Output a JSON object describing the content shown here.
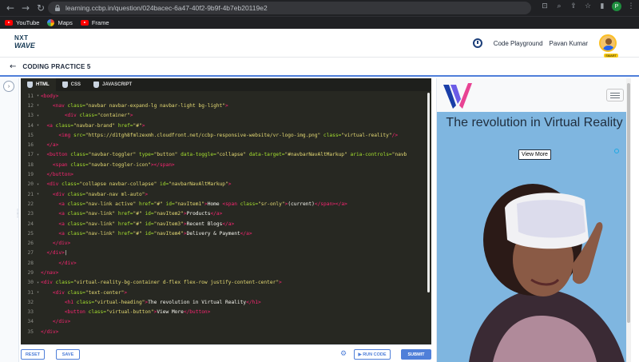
{
  "browser": {
    "url": "learning.ccbp.in/question/024bacec-6a47-40f2-9b9f-4b7eb20119e2",
    "profile_initial": "P",
    "bookmarks": [
      {
        "label": "YouTube",
        "icon": "youtube-icon"
      },
      {
        "label": "Maps",
        "icon": "google-icon"
      },
      {
        "label": "Frame",
        "icon": "youtube-icon"
      }
    ]
  },
  "header": {
    "logo_top": "NXT",
    "logo_bottom": "WAVE",
    "code_playground": "Code Playground",
    "user_name": "Pavan Kumar",
    "avatar_badge": "SMART"
  },
  "practice": {
    "title": "CODING PRACTICE 5"
  },
  "editor": {
    "tabs": [
      "HTML",
      "CSS",
      "JAVASCRIPT"
    ],
    "active_tab": "HTML",
    "lines": [
      {
        "n": "11",
        "fold": "▾",
        "indent": "",
        "parts": [
          [
            "tag",
            "<body>"
          ]
        ]
      },
      {
        "n": "12",
        "fold": "▾",
        "indent": "    ",
        "parts": [
          [
            "tag",
            "<nav "
          ],
          [
            "attr",
            "class="
          ],
          [
            "str",
            "\"navbar navbar-expand-lg navbar-light bg-light\""
          ],
          [
            "tag",
            ">"
          ]
        ]
      },
      {
        "n": "13",
        "fold": "▾",
        "indent": "        ",
        "parts": [
          [
            "tag",
            "<div "
          ],
          [
            "attr",
            "class="
          ],
          [
            "str",
            "\"container\""
          ],
          [
            "tag",
            ">"
          ]
        ]
      },
      {
        "n": "14",
        "fold": "▾",
        "indent": "  ",
        "parts": [
          [
            "tag",
            "<a "
          ],
          [
            "attr",
            "class="
          ],
          [
            "str",
            "\"navbar-brand\" "
          ],
          [
            "attr",
            "href="
          ],
          [
            "str",
            "\"#\""
          ],
          [
            "tag",
            ">"
          ]
        ]
      },
      {
        "n": "15",
        "fold": "",
        "indent": "      ",
        "parts": [
          [
            "tag",
            "<img "
          ],
          [
            "attr",
            "src="
          ],
          [
            "str",
            "\"https://d1tgh8fmlzexmh.cloudfront.net/ccbp-responsive-website/vr-logo-img.png\" "
          ],
          [
            "attr",
            "class="
          ],
          [
            "str",
            "\"virtual-reality\""
          ],
          [
            "tag",
            "/>"
          ]
        ]
      },
      {
        "n": "16",
        "fold": "",
        "indent": "  ",
        "parts": [
          [
            "tag",
            "</a>"
          ]
        ]
      },
      {
        "n": "17",
        "fold": "▾",
        "indent": "  ",
        "parts": [
          [
            "tag",
            "<button "
          ],
          [
            "attr",
            "class="
          ],
          [
            "str",
            "\"navbar-toggler\" "
          ],
          [
            "attr",
            "type="
          ],
          [
            "str",
            "\"button\" "
          ],
          [
            "attr",
            "data-toggle="
          ],
          [
            "str",
            "\"collapse\" "
          ],
          [
            "attr",
            "data-target="
          ],
          [
            "str",
            "\"#navbarNavAltMarkup\" "
          ],
          [
            "attr",
            "aria-controls="
          ],
          [
            "str",
            "\"navb"
          ]
        ]
      },
      {
        "n": "18",
        "fold": "",
        "indent": "    ",
        "parts": [
          [
            "tag",
            "<span "
          ],
          [
            "attr",
            "class="
          ],
          [
            "str",
            "\"navbar-toggler-icon\""
          ],
          [
            "tag",
            "></span>"
          ]
        ]
      },
      {
        "n": "19",
        "fold": "",
        "indent": "  ",
        "parts": [
          [
            "tag",
            "</button>"
          ]
        ]
      },
      {
        "n": "20",
        "fold": "▾",
        "indent": "  ",
        "parts": [
          [
            "tag",
            "<div "
          ],
          [
            "attr",
            "class="
          ],
          [
            "str",
            "\"collapse navbar-collapse\" "
          ],
          [
            "attr",
            "id="
          ],
          [
            "str",
            "\"navbarNavAltMarkup\""
          ],
          [
            "tag",
            ">"
          ]
        ]
      },
      {
        "n": "21",
        "fold": "▾",
        "indent": "    ",
        "parts": [
          [
            "tag",
            "<div "
          ],
          [
            "attr",
            "class="
          ],
          [
            "str",
            "\"navbar-nav ml-auto\""
          ],
          [
            "tag",
            ">"
          ]
        ]
      },
      {
        "n": "22",
        "fold": "",
        "indent": "      ",
        "parts": [
          [
            "tag",
            "<a "
          ],
          [
            "attr",
            "class="
          ],
          [
            "str",
            "\"nav-link active\" "
          ],
          [
            "attr",
            "href="
          ],
          [
            "str",
            "\"#\" "
          ],
          [
            "attr",
            "id="
          ],
          [
            "str",
            "\"navItem1\""
          ],
          [
            "tag",
            ">"
          ],
          [
            "txt",
            "Home "
          ],
          [
            "tag",
            "<span "
          ],
          [
            "attr",
            "class="
          ],
          [
            "str",
            "\"sr-only\""
          ],
          [
            "tag",
            ">"
          ],
          [
            "txt",
            "(current)"
          ],
          [
            "tag",
            "</span></a>"
          ]
        ]
      },
      {
        "n": "23",
        "fold": "",
        "indent": "      ",
        "parts": [
          [
            "tag",
            "<a "
          ],
          [
            "attr",
            "class="
          ],
          [
            "str",
            "\"nav-link\" "
          ],
          [
            "attr",
            "href="
          ],
          [
            "str",
            "\"#\" "
          ],
          [
            "attr",
            "id="
          ],
          [
            "str",
            "\"navItem2\""
          ],
          [
            "tag",
            ">"
          ],
          [
            "txt",
            "Products"
          ],
          [
            "tag",
            "</a>"
          ]
        ]
      },
      {
        "n": "24",
        "fold": "",
        "indent": "      ",
        "parts": [
          [
            "tag",
            "<a "
          ],
          [
            "attr",
            "class="
          ],
          [
            "str",
            "\"nav-link\" "
          ],
          [
            "attr",
            "href="
          ],
          [
            "str",
            "\"#\" "
          ],
          [
            "attr",
            "id="
          ],
          [
            "str",
            "\"navItem3\""
          ],
          [
            "tag",
            ">"
          ],
          [
            "txt",
            "Recent Blogs"
          ],
          [
            "tag",
            "</a>"
          ]
        ]
      },
      {
        "n": "25",
        "fold": "",
        "indent": "      ",
        "parts": [
          [
            "tag",
            "<a "
          ],
          [
            "attr",
            "class="
          ],
          [
            "str",
            "\"nav-link\" "
          ],
          [
            "attr",
            "href="
          ],
          [
            "str",
            "\"#\" "
          ],
          [
            "attr",
            "id="
          ],
          [
            "str",
            "\"navItem4\""
          ],
          [
            "tag",
            ">"
          ],
          [
            "txt",
            "Delivery & Payment"
          ],
          [
            "tag",
            "</a>"
          ]
        ]
      },
      {
        "n": "26",
        "fold": "",
        "indent": "    ",
        "parts": [
          [
            "tag",
            "</div>"
          ]
        ]
      },
      {
        "n": "27",
        "fold": "",
        "indent": "  ",
        "parts": [
          [
            "tag",
            "</div>"
          ],
          [
            "txt",
            "|"
          ]
        ]
      },
      {
        "n": "28",
        "fold": "",
        "indent": "      ",
        "parts": [
          [
            "tag",
            "</div>"
          ]
        ]
      },
      {
        "n": "29",
        "fold": "",
        "indent": "",
        "parts": [
          [
            "tag",
            "</nav>"
          ]
        ]
      },
      {
        "n": "30",
        "fold": "▾",
        "indent": "",
        "parts": [
          [
            "tag",
            "<div "
          ],
          [
            "attr",
            "class="
          ],
          [
            "str",
            "\"virtual-reality-bg-container d-flex flex-row justify-content-center\""
          ],
          [
            "tag",
            ">"
          ]
        ]
      },
      {
        "n": "31",
        "fold": "▾",
        "indent": "    ",
        "parts": [
          [
            "tag",
            "<div "
          ],
          [
            "attr",
            "class="
          ],
          [
            "str",
            "\"text-center\""
          ],
          [
            "tag",
            ">"
          ]
        ]
      },
      {
        "n": "32",
        "fold": "",
        "indent": "        ",
        "parts": [
          [
            "tag",
            "<h1 "
          ],
          [
            "attr",
            "class="
          ],
          [
            "str",
            "\"virtual-heading\""
          ],
          [
            "tag",
            ">"
          ],
          [
            "txt",
            "The revolution in Virtual Reality"
          ],
          [
            "tag",
            "</h1>"
          ]
        ]
      },
      {
        "n": "33",
        "fold": "",
        "indent": "        ",
        "parts": [
          [
            "tag",
            "<button "
          ],
          [
            "attr",
            "class="
          ],
          [
            "str",
            "\"virtual-button\""
          ],
          [
            "tag",
            ">"
          ],
          [
            "txt",
            "View More"
          ],
          [
            "tag",
            "</button>"
          ]
        ]
      },
      {
        "n": "34",
        "fold": "",
        "indent": "    ",
        "parts": [
          [
            "tag",
            "</div>"
          ]
        ]
      },
      {
        "n": "35",
        "fold": "",
        "indent": "",
        "parts": [
          [
            "tag",
            "</div>"
          ]
        ]
      }
    ]
  },
  "actions": {
    "reset": "RESET",
    "save": "SAVE",
    "run_code": "▶ RUN CODE",
    "submit": "SUBMIT"
  },
  "preview": {
    "heading": "The revolution in Virtual Reality",
    "button": "View More"
  },
  "colors": {
    "accent": "#4f7fd9",
    "editor_bg": "#272822",
    "tag": "#f92672",
    "attr": "#a6e22e",
    "string": "#e6db74"
  }
}
